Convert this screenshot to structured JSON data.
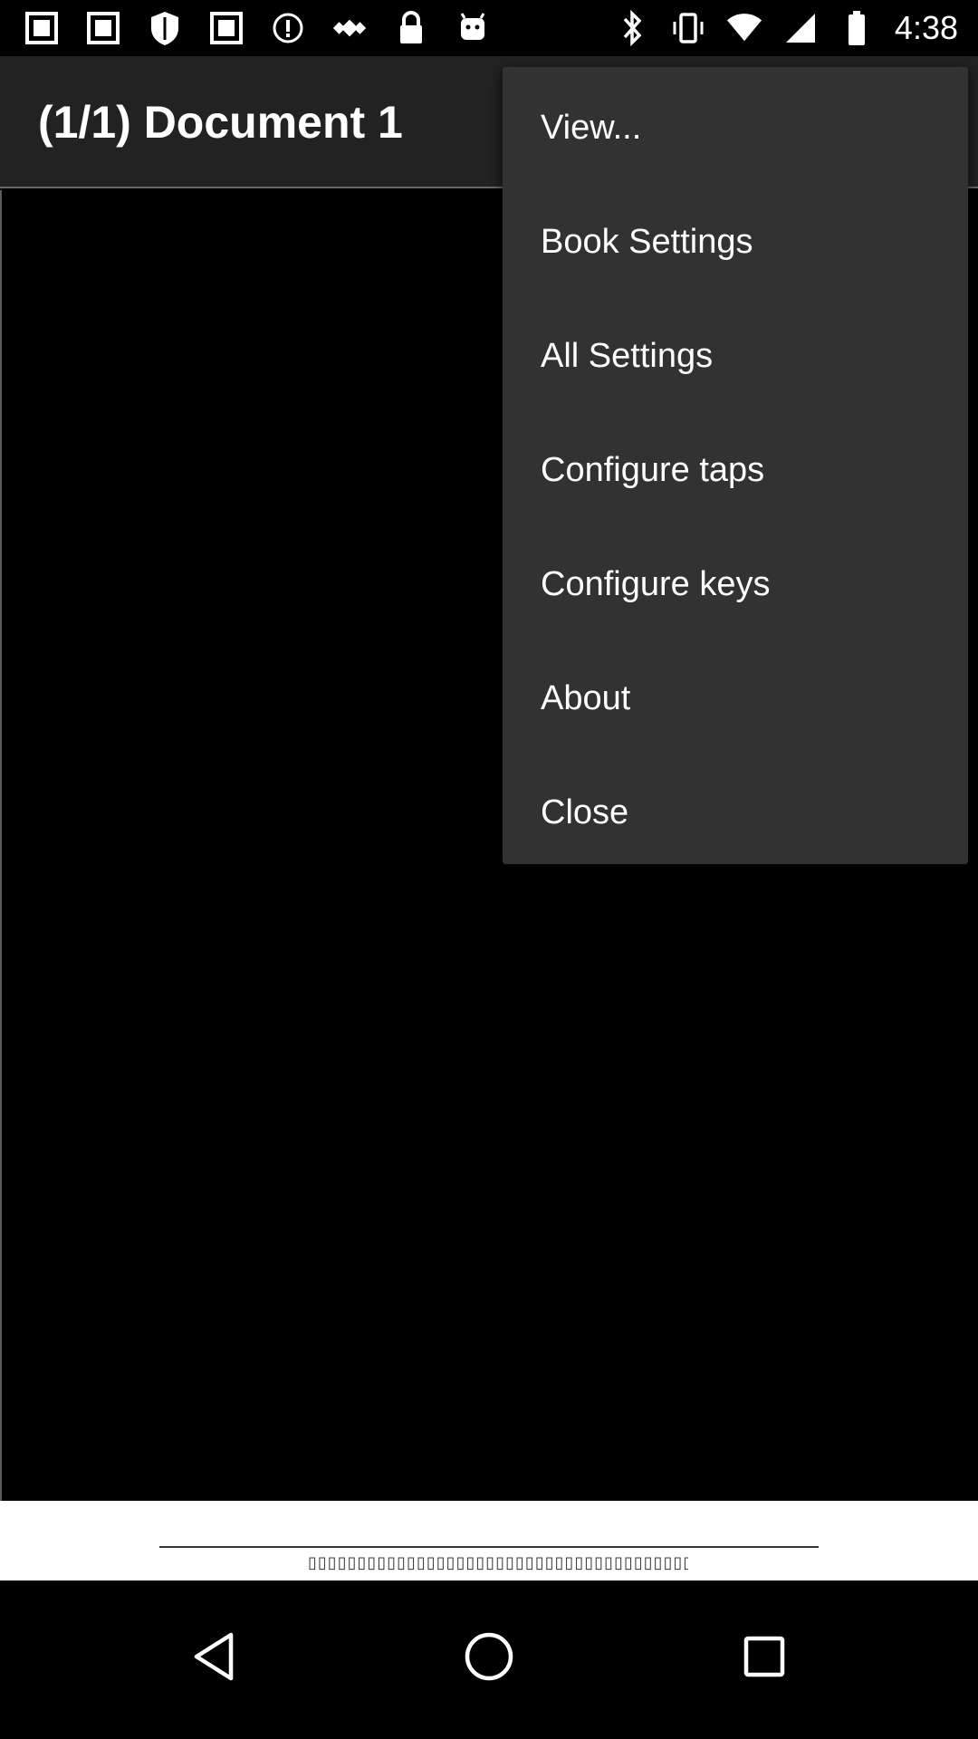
{
  "status_bar": {
    "time": "4:38",
    "icons_left": [
      "image-icon",
      "image-icon",
      "shield-icon",
      "image-icon",
      "info-icon",
      "fake-gps-icon",
      "lock-icon",
      "android-icon"
    ],
    "icons_right": [
      "bluetooth-icon",
      "vibrate-icon",
      "wifi-icon",
      "signal-icon",
      "battery-icon"
    ]
  },
  "app_bar": {
    "title": "(1/1) Document 1"
  },
  "footer": {
    "text": "▯▯▯▯▯▯▯▯▯▯▯▯▯▯▯▯▯▯▯▯▯▯▯▯▯▯▯▯▯▯▯▯▯▯▯▯▯▯▯▯▯▯▯▯▯▯▯▯"
  },
  "menu": {
    "items": [
      {
        "label": "View..."
      },
      {
        "label": "Book Settings"
      },
      {
        "label": "All Settings"
      },
      {
        "label": "Configure taps"
      },
      {
        "label": "Configure keys"
      },
      {
        "label": "About"
      },
      {
        "label": "Close"
      }
    ]
  },
  "nav": {
    "back": "back-icon",
    "home": "home-icon",
    "recents": "recents-icon"
  },
  "colors": {
    "menu_bg": "#323232",
    "app_bar_bg": "#222222",
    "background": "#000000",
    "text": "#ffffff"
  }
}
